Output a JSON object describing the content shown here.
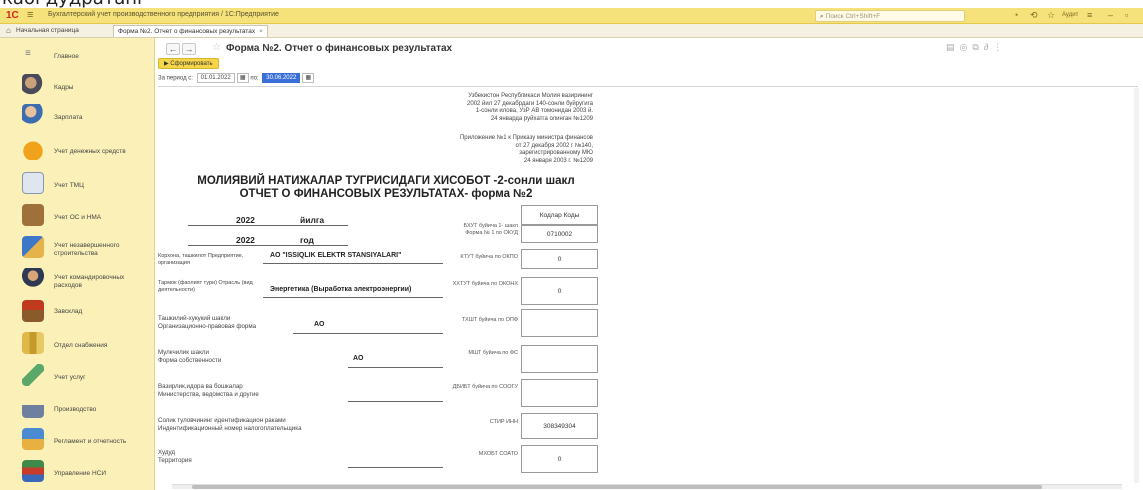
{
  "caption": {
    "text": "кабі дудратані"
  },
  "titlebar": {
    "logo": "1С",
    "menu": "≡",
    "app_title": "Бухгалтерский учет производственного предприятия / 1С:Предприятие",
    "search_placeholder": "Поиск Ctrl+Shift+F",
    "user": "Аудит"
  },
  "tabs": {
    "home": "Начальная страница",
    "active": "Форма №2. Отчет о финансовых результатах"
  },
  "sidebar": {
    "items": [
      {
        "label": "Главное",
        "icon": "menu-icon"
      },
      {
        "label": "Кадры",
        "icon": "people-icon"
      },
      {
        "label": "Зарплата",
        "icon": "salary-icon"
      },
      {
        "label": "Учет денежных средств",
        "icon": "money-bag-icon"
      },
      {
        "label": "Учет ТМЦ",
        "icon": "inventory-icon"
      },
      {
        "label": "Учет ОС и НМА",
        "icon": "box-icon"
      },
      {
        "label": "Учет незавершенного строительства",
        "icon": "construction-icon"
      },
      {
        "label": "Учет командировочных расходов",
        "icon": "travel-icon"
      },
      {
        "label": "Завсклад",
        "icon": "warehouse-icon"
      },
      {
        "label": "Отдел снабжения",
        "icon": "folders-icon"
      },
      {
        "label": "Учет услуг",
        "icon": "pen-icon"
      },
      {
        "label": "Производство",
        "icon": "factory-icon"
      },
      {
        "label": "Регламент и отчетность",
        "icon": "report-icon"
      },
      {
        "label": "Управление НСИ",
        "icon": "books-icon"
      }
    ]
  },
  "main": {
    "form_title": "Форма №2. Отчет о финансовых результатах",
    "generate_button": "Сформировать",
    "period_label": "За период с:",
    "period_from": "01.01.2022",
    "period_to_label": "по:",
    "period_to": "30.06.2022"
  },
  "report": {
    "note_uz": [
      "Узбекистон Республикаси Молия вазирининг",
      "2002 йил 27 декабрдаги 140-сонли буйругига",
      "1-сонли илова, УзР АВ томонидан 2003 й.",
      "24 январда руйхатга олинган №1209"
    ],
    "note_ru": [
      "Приложение №1 к Приказу министра финансов",
      "от 27 декабря 2002 г №140,",
      "зарегистрированному МЮ",
      "24 января 2003 г. №1209"
    ],
    "title_line1": "МОЛИЯВИЙ НАТИЖАЛАР ТУГРИСИДАГИ ХИСОБОТ -2-сонли шакл",
    "title_line2": "ОТЧЕТ О ФИНАНСОВЫХ РЕЗУЛЬТАТАХ- форма №2",
    "year1": "2022",
    "year1_word": "йилга",
    "year2": "2022",
    "year2_word": "год",
    "codes_header": "Кодлар Коды",
    "okud_label": "БХУТ буйича 1- шакл Форма № 1 по ОКУД",
    "okud_value": "0710002",
    "org_label": "Корхона, ташкилот Предприятие, организация",
    "org_value": "АО \"ISSIQLIK ELEKTR STANSIYALARI\"",
    "okpo_label": "КТУТ буйича по ОКПО",
    "okpo_value": "0",
    "branch_label": "Тармок (фаолият тури) Отрасль (вид деятельности)",
    "branch_value": "Энергетика (Выработка электроэнергии)",
    "okonh_label": "ХХТУТ буйича по ОКОНХ",
    "okonh_value": "0",
    "opf_label_line1": "Ташкилий-хукукий шакли",
    "opf_label_line2": "Организационно-правовая форма",
    "opf_value": "АО",
    "opf_code_label": "ТХШТ буйича по ОПФ",
    "fs_label_line1": "Мулкчилик шакли",
    "fs_label_line2": "Форма собственности",
    "fs_value": "АО",
    "fs_code_label": "МШТ буйича по ФС",
    "ministry_label_line1": "Вазирлик,идора ва бошкалар",
    "ministry_label_line2": "Министерства, ведомства и другие",
    "soogu_label": "ДБИБТ буйича по СООГУ",
    "inn_label_line1": "Солик туловчининг идентификацион раками",
    "inn_label_line2": "Индентификационный номер налогоплательщика",
    "inn_code_label": "СТИР ИНН",
    "inn_value": "308349304",
    "territory_label_line1": "Худуд",
    "territory_label_line2": "Территория",
    "soato_label": "МХОБТ СОАТО",
    "soato_value": "0"
  }
}
